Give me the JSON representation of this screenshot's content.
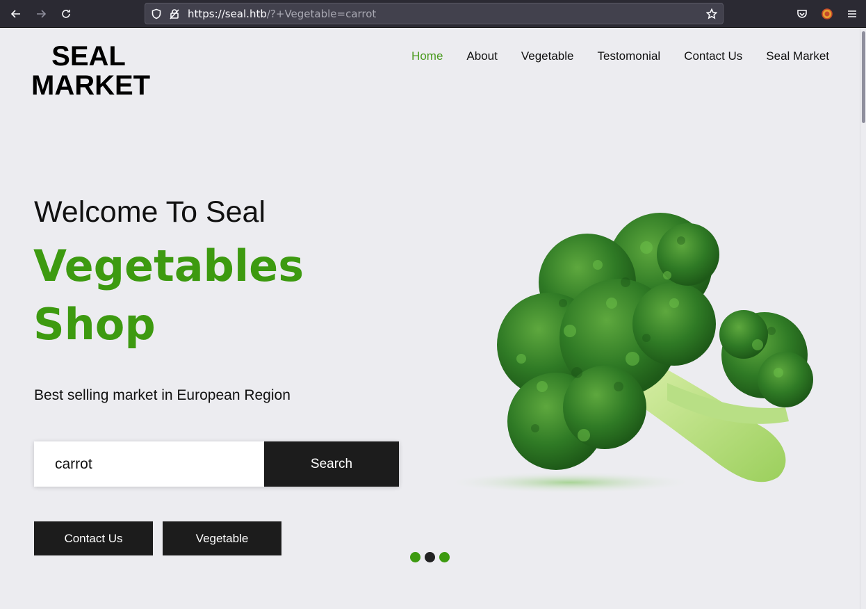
{
  "browser": {
    "url_host": "https://seal.htb",
    "url_rest": "/?+Vegetable=carrot"
  },
  "site": {
    "logo_line1": "SEAL",
    "logo_line2": "MARKET",
    "nav": [
      {
        "label": "Home",
        "active": true
      },
      {
        "label": "About"
      },
      {
        "label": "Vegetable"
      },
      {
        "label": "Testomonial"
      },
      {
        "label": "Contact Us"
      },
      {
        "label": "Seal Market"
      }
    ]
  },
  "hero": {
    "welcome": "Welcome To Seal",
    "headline_line1": "Vegetables",
    "headline_line2": "Shop",
    "tagline": "Best selling market in European Region",
    "search_value": "carrot",
    "search_button": "Search",
    "contact_button": "Contact Us",
    "vegetable_button": "Vegetable"
  },
  "colors": {
    "accent_green": "#3d9a10",
    "dark_button": "#1c1c1c",
    "page_bg": "#ececf0"
  },
  "icons": [
    "back-arrow-icon",
    "forward-arrow-icon",
    "reload-icon",
    "shield-icon",
    "insecure-lock-icon",
    "bookmark-star-icon",
    "pocket-icon",
    "extension-icon",
    "menu-icon"
  ]
}
